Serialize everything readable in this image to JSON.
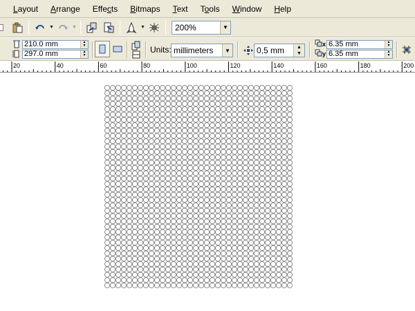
{
  "menu": {
    "items": [
      {
        "label": "Layout",
        "key": "L",
        "rest": "ayout"
      },
      {
        "label": "Arrange",
        "key": "A",
        "rest": "rrange"
      },
      {
        "label": "Effects",
        "key": "",
        "pre": "Effe",
        "mid": "c",
        "post": "ts"
      },
      {
        "label": "Bitmaps",
        "key": "B",
        "rest": "itmaps"
      },
      {
        "label": "Text",
        "key": "T",
        "rest": "ext"
      },
      {
        "label": "Tools",
        "key": "",
        "pre": "T",
        "mid": "o",
        "post": "ols"
      },
      {
        "label": "Window",
        "key": "W",
        "rest": "indow"
      },
      {
        "label": "Help",
        "key": "H",
        "rest": "elp"
      }
    ]
  },
  "toolbar": {
    "zoom_value": "200%",
    "icons": [
      "copy-icon",
      "paste-icon",
      "undo-icon",
      "redo-icon",
      "import-icon",
      "export-icon",
      "application-launcher-icon",
      "corel-online-icon"
    ]
  },
  "property_bar": {
    "page_width": "210.0 mm",
    "page_height": "297.0 mm",
    "units_label": "Units:",
    "units_value": "millimeters",
    "nudge_value": "0,5 mm",
    "duplicate_x": "6.35 mm",
    "duplicate_y": "6.35 mm",
    "dup_x_sub": "x",
    "dup_y_sub": "y"
  },
  "ruler": {
    "labels": [
      "20",
      "40",
      "60",
      "80",
      "100",
      "120",
      "140",
      "160",
      "180",
      "200"
    ]
  },
  "colors": {
    "chrome": "#ece9d8",
    "field_border": "#7f9db9",
    "circle_stroke": "#808080"
  }
}
